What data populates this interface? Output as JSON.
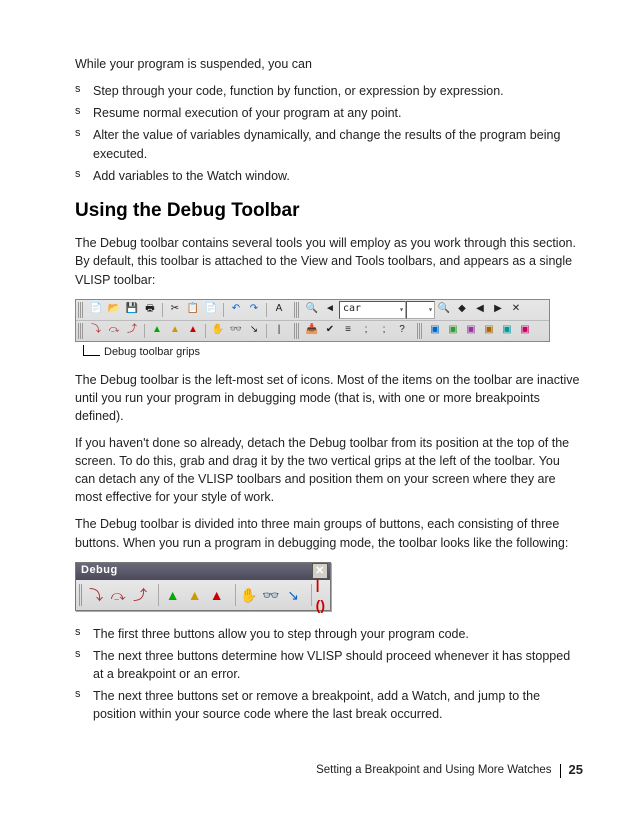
{
  "intro": "While your program is suspended, you can",
  "list1": [
    "Step through your code, function by function, or expression by expression.",
    "Resume normal execution of your program at any point.",
    "Alter the value of variables dynamically, and change the results of the program being executed.",
    "Add variables to the Watch window."
  ],
  "heading": "Using the Debug Toolbar",
  "para1": "The Debug toolbar contains several tools you will employ as you work through this section. By default, this toolbar is attached to the View and Tools toolbars, and appears as a single VLISP toolbar:",
  "toolbar_caption": "Debug toolbar grips",
  "combo1": "car",
  "para2": "The Debug toolbar is the left-most set of icons. Most of the items on the toolbar are inactive until you run your program in debugging mode (that is, with one or more breakpoints defined).",
  "para3": "If you haven't done so already, detach the Debug toolbar from its position at the top of the screen. To do this, grab and drag it by the two vertical grips at the left of the toolbar. You can detach any of the VLISP toolbars and position them on your screen where they are most effective for your style of work.",
  "para4": "The Debug toolbar is divided into three main groups of buttons, each consisting of three buttons. When you run a program in debugging mode, the toolbar looks like the following:",
  "debug_title": "Debug",
  "close_glyph": "✕",
  "list2": [
    "The first three buttons allow you to step through your program code.",
    "The next three buttons determine how VLISP should proceed whenever it has stopped at a breakpoint or an error.",
    "The next three buttons set or remove a breakpoint, add a Watch, and jump to the position within your source code where the last break occurred."
  ],
  "footer_text": "Setting a Breakpoint and Using More Watches",
  "page_number": "25"
}
